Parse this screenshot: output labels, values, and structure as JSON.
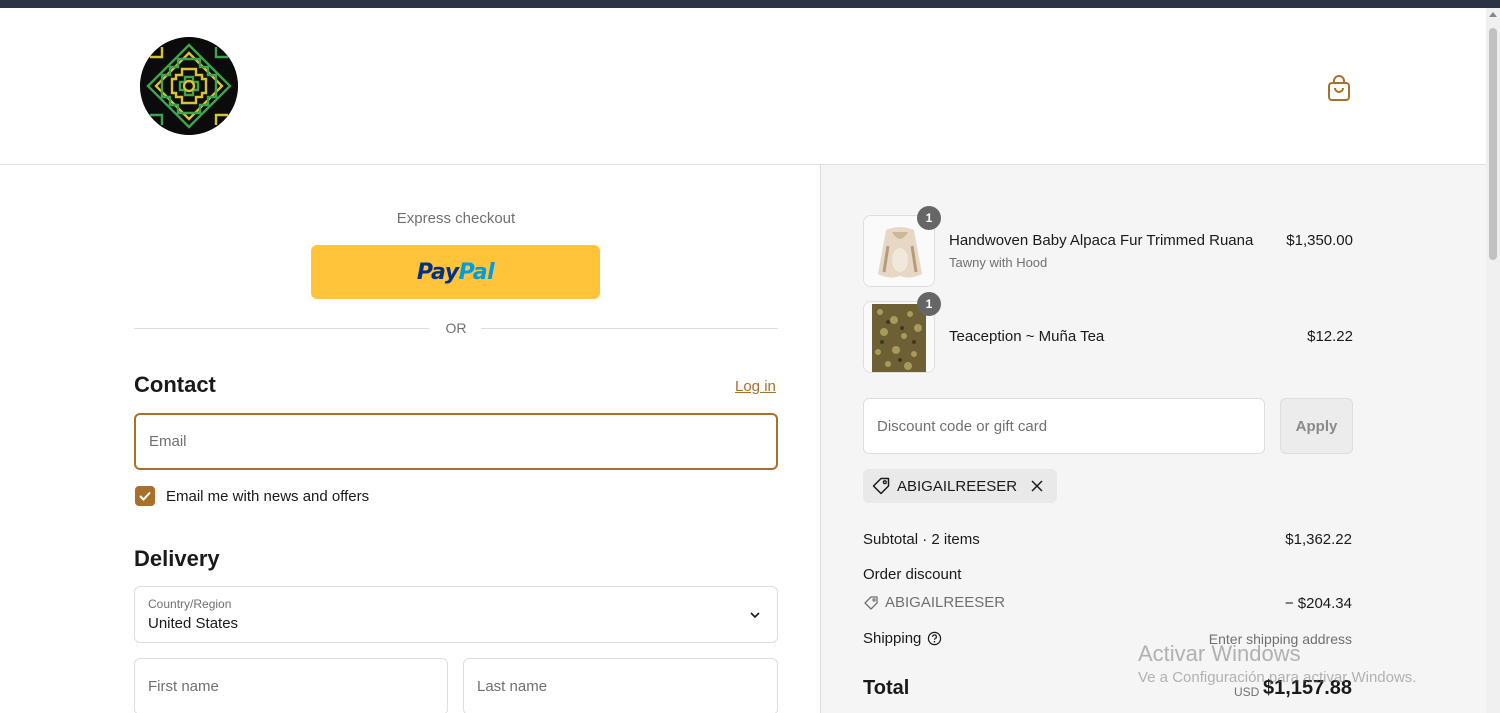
{
  "colors": {
    "accent": "#a8702a",
    "paypal_yellow": "#ffc439",
    "paypal_dark": "#003087",
    "paypal_light": "#009cde",
    "summary_bg": "#f5f5f5"
  },
  "header": {
    "logo_icon": "store-logo",
    "cart_icon": "shopping-bag-icon"
  },
  "express": {
    "label": "Express checkout",
    "paypal_pay": "Pay",
    "paypal_pal": "Pal",
    "or_text": "OR"
  },
  "contact": {
    "title": "Contact",
    "login_label": "Log in",
    "email_placeholder": "Email",
    "newsletter_label": "Email me with news and offers",
    "newsletter_checked": true
  },
  "delivery": {
    "title": "Delivery",
    "country_label": "Country/Region",
    "country_value": "United States",
    "first_name_placeholder": "First name",
    "last_name_placeholder": "Last name"
  },
  "cart": {
    "items": [
      {
        "name": "Handwoven Baby Alpaca Fur Trimmed Ruana",
        "variant": "Tawny with Hood",
        "price": "$1,350.00",
        "quantity": "1"
      },
      {
        "name": "Teaception ~ Muña Tea",
        "variant": "",
        "price": "$12.22",
        "quantity": "1"
      }
    ],
    "discount_placeholder": "Discount code or gift card",
    "apply_label": "Apply",
    "applied_code": "ABIGAILREESER"
  },
  "summary": {
    "subtotal_label": "Subtotal · 2 items",
    "subtotal_value": "$1,362.22",
    "order_discount_label": "Order discount",
    "discount_code": "ABIGAILREESER",
    "discount_value": "− $204.34",
    "shipping_label": "Shipping",
    "shipping_value": "Enter shipping address",
    "total_label": "Total",
    "currency": "USD",
    "total_value": "$1,157.88"
  },
  "watermark": {
    "title": "Activar Windows",
    "subtitle": "Ve a Configuración para activar Windows."
  }
}
